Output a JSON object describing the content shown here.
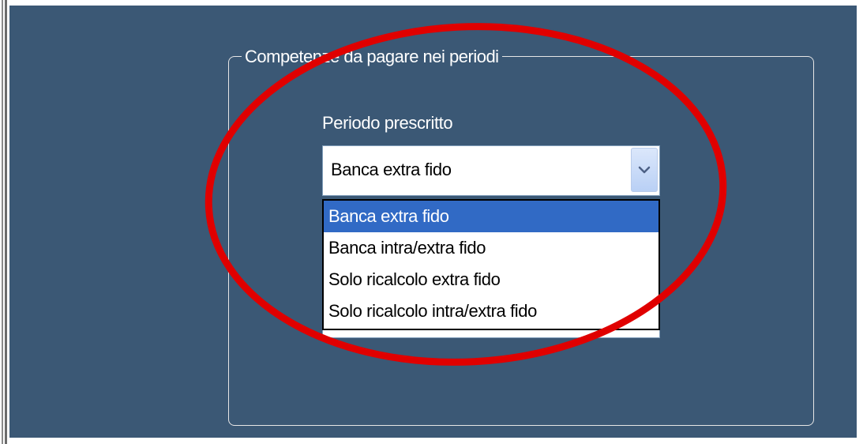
{
  "group": {
    "legend": "Competenze da pagare nei periodi"
  },
  "field": {
    "label": "Periodo prescritto",
    "selected_value": "Banca extra fido",
    "options": [
      "Banca extra fido",
      "Banca intra/extra fido",
      "Solo ricalcolo extra fido",
      "Solo ricalcolo intra/extra fido"
    ],
    "highlighted_option": "Banca extra fido",
    "arrow_icon": "chevron-down-icon"
  },
  "colors": {
    "panel_background": "#3b5875",
    "highlight": "#316ac5",
    "annotation_ellipse": "#e00000",
    "text_light": "#ffffff"
  }
}
